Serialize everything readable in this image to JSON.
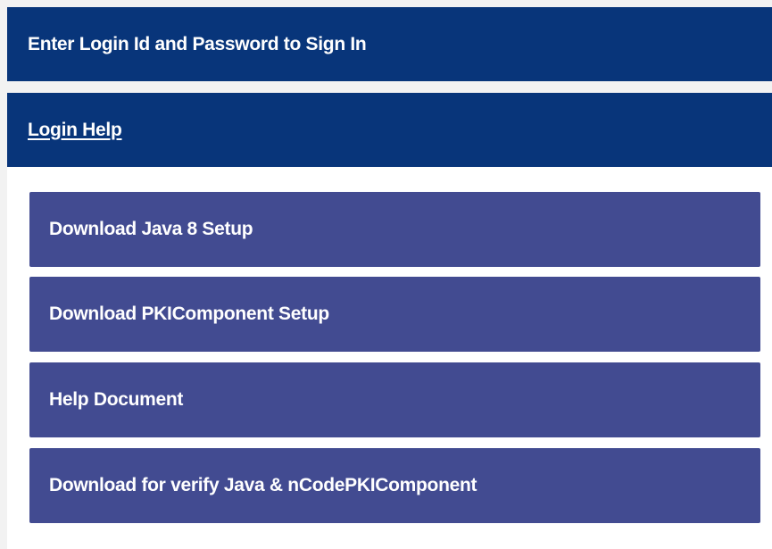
{
  "signin_header": {
    "text": "Enter Login Id and Password to Sign In"
  },
  "login_help": {
    "title": "Login Help",
    "items": [
      {
        "label": "Download Java 8 Setup"
      },
      {
        "label": "Download PKIComponent Setup"
      },
      {
        "label": "Help Document"
      },
      {
        "label": "Download for verify Java & nCodePKIComponent"
      }
    ]
  },
  "colors": {
    "header_bg": "#08357a",
    "item_bg": "#424b91",
    "body_bg": "#ffffff",
    "text": "#ffffff"
  }
}
